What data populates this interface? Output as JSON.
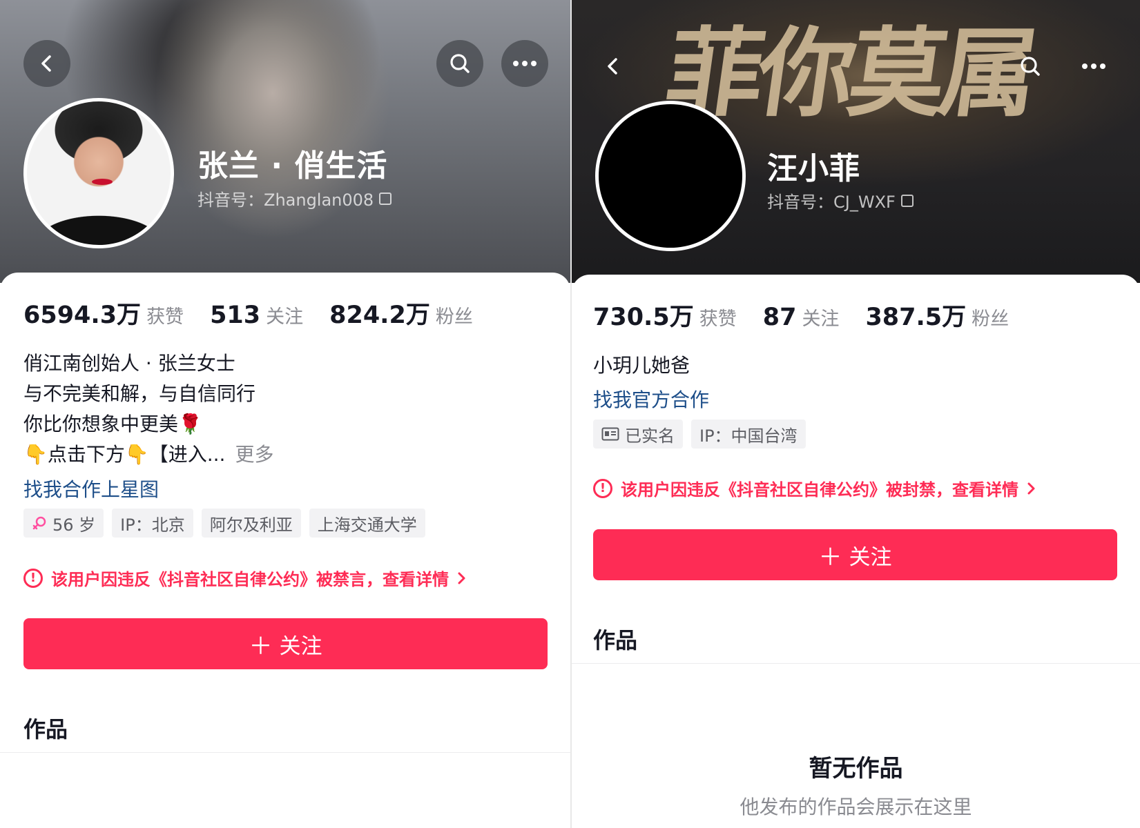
{
  "left": {
    "name": "张兰 · 俏生活",
    "douyin_id": "抖音号：Zhanglan008",
    "stats": [
      {
        "value": "6594.3万",
        "label": "获赞"
      },
      {
        "value": "513",
        "label": "关注"
      },
      {
        "value": "824.2万",
        "label": "粉丝"
      }
    ],
    "bio_lines": [
      "俏江南创始人 · 张兰女士",
      "与不完美和解，与自信同行",
      "你比你想象中更美🌹",
      "👇点击下方👇【进入..."
    ],
    "more_label": "更多",
    "link": "找我合作上星图",
    "tags": [
      {
        "icon": "female-icon",
        "text": "56 岁"
      },
      {
        "text": "IP：北京"
      },
      {
        "text": "阿尔及利亚"
      },
      {
        "text": "上海交通大学"
      }
    ],
    "warning": "该用户因违反《抖音社区自律公约》被禁言，查看详情",
    "follow_label": "关注",
    "works_title": "作品"
  },
  "right": {
    "banner_art_text": "菲你莫属",
    "name": "汪小菲",
    "douyin_id": "抖音号：CJ_WXF",
    "stats": [
      {
        "value": "730.5万",
        "label": "获赞"
      },
      {
        "value": "87",
        "label": "关注"
      },
      {
        "value": "387.5万",
        "label": "粉丝"
      }
    ],
    "bio_lines": [
      "小玥儿她爸"
    ],
    "link": "找我官方合作",
    "tags": [
      {
        "icon": "id-card-icon",
        "text": "已实名"
      },
      {
        "text": "IP：中国台湾"
      }
    ],
    "warning": "该用户因违反《抖音社区自律公约》被封禁，查看详情",
    "follow_label": "关注",
    "works_title": "作品",
    "empty_title": "暂无作品",
    "empty_subtitle": "他发布的作品会展示在这里"
  },
  "colors": {
    "accent": "#fe2c55",
    "link": "#1d4e89",
    "muted": "#8a8b91"
  }
}
